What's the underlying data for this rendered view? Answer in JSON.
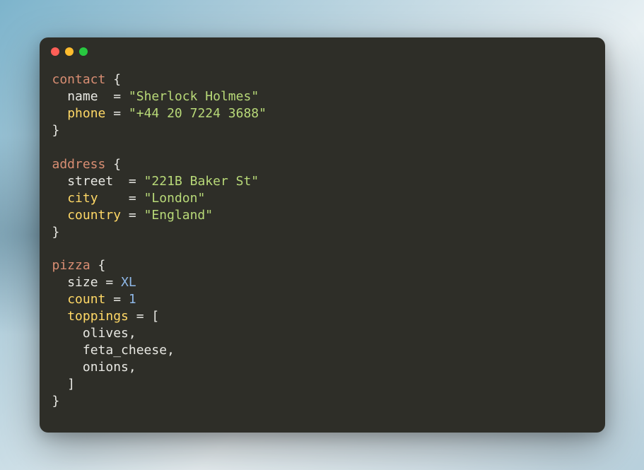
{
  "code": {
    "contact": {
      "block_name": "contact",
      "name_key": "name",
      "name_val": "\"Sherlock Holmes\"",
      "phone_key": "phone",
      "phone_val": "\"+44 20 7224 3688\""
    },
    "address": {
      "block_name": "address",
      "street_key": "street",
      "street_val": "\"221B Baker St\"",
      "city_key": "city",
      "city_val": "\"London\"",
      "country_key": "country",
      "country_val": "\"England\""
    },
    "pizza": {
      "block_name": "pizza",
      "size_key": "size",
      "size_val": "XL",
      "count_key": "count",
      "count_val": "1",
      "toppings_key": "toppings",
      "toppings": {
        "t0": "olives",
        "t1": "feta_cheese",
        "t2": "onions"
      }
    },
    "eq": "=",
    "lbrace": "{",
    "rbrace": "}",
    "lbracket": "[",
    "rbracket": "]",
    "comma": ","
  }
}
